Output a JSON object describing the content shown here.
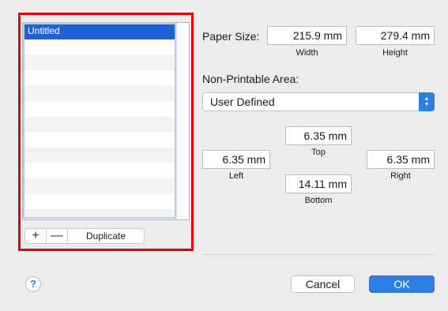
{
  "list": {
    "items": [
      "Untitled",
      "",
      "",
      "",
      "",
      "",
      "",
      "",
      "",
      "",
      "",
      "",
      ""
    ]
  },
  "list_actions": {
    "add_label": "+",
    "remove_label": "—",
    "duplicate_label": "Duplicate"
  },
  "paper_size": {
    "label": "Paper Size:",
    "width_value": "215.9 mm",
    "width_caption": "Width",
    "height_value": "279.4 mm",
    "height_caption": "Height"
  },
  "non_printable": {
    "label": "Non-Printable Area:",
    "selected": "User Defined",
    "top_value": "6.35 mm",
    "top_caption": "Top",
    "left_value": "6.35 mm",
    "left_caption": "Left",
    "right_value": "6.35 mm",
    "right_caption": "Right",
    "bottom_value": "14.11 mm",
    "bottom_caption": "Bottom"
  },
  "footer": {
    "help_label": "?",
    "cancel_label": "Cancel",
    "ok_label": "OK"
  },
  "colors": {
    "highlight": "#e8000d",
    "selection": "#1b63d6",
    "accent": "#2f7ee6"
  }
}
